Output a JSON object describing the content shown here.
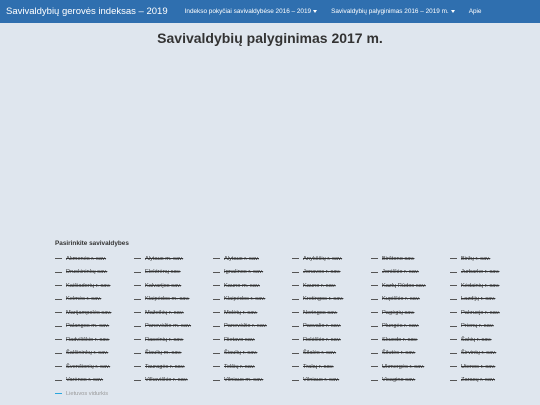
{
  "navbar": {
    "brand": "Savivaldybių gerovės indeksas – 2019",
    "items": [
      {
        "label": "Indekso pokyčiai savivaldybėse 2016 – 2019",
        "dropdown": true
      },
      {
        "label": "Savivaldybių palyginimas 2016 – 2019 m.",
        "dropdown": true
      },
      {
        "label": "Apie",
        "dropdown": false
      }
    ]
  },
  "page": {
    "title": "Savivaldybių palyginimas 2017 m."
  },
  "selector": {
    "title": "Pasirinkite savivaldybes",
    "items": [
      "Akmenės r. sav.",
      "Alytaus m. sav.",
      "Alytaus r. sav.",
      "Anykščių r. sav.",
      "Birštono sav.",
      "Biržų r. sav.",
      "Druskininkų sav.",
      "Elektrėnų sav.",
      "Ignalinos r. sav.",
      "Jonavos r. sav.",
      "Joniškio r. sav.",
      "Jurbarko r. sav.",
      "Kaišiadorių r. sav.",
      "Kalvarijos sav.",
      "Kauno m. sav.",
      "Kauno r. sav.",
      "Kazlų Rūdos sav.",
      "Kėdainių r. sav.",
      "Kelmės r. sav.",
      "Klaipėdos m. sav.",
      "Klaipėdos r. sav.",
      "Kretingos r. sav.",
      "Kupiškio r. sav.",
      "Lazdijų r. sav.",
      "Marijampolės sav.",
      "Mažeikių r. sav.",
      "Molėtų r. sav.",
      "Neringos sav.",
      "Pagėgių sav.",
      "Pakruojo r. sav.",
      "Palangos m. sav.",
      "Panevėžio m. sav.",
      "Panevėžio r. sav.",
      "Pasvalio r. sav.",
      "Plungės r. sav.",
      "Prienų r. sav.",
      "Radviliškio r. sav.",
      "Raseinių r. sav.",
      "Rietavo sav.",
      "Rokiškio r. sav.",
      "Skuodo r. sav.",
      "Šakių r. sav.",
      "Šalčininkų r. sav.",
      "Šiaulių m. sav.",
      "Šiaulių r. sav.",
      "Šilalės r. sav.",
      "Šilutės r. sav.",
      "Širvintų r. sav.",
      "Švenčionių r. sav.",
      "Tauragės r. sav.",
      "Telšių r. sav.",
      "Trakų r. sav.",
      "Ukmergės r. sav.",
      "Utenos r. sav.",
      "Varėnos r. sav.",
      "Vilkaviškio r. sav.",
      "Vilniaus m. sav.",
      "Vilniaus r. sav.",
      "Visagino sav.",
      "Zarasų r. sav."
    ],
    "average": "Lietuvos vidurkis",
    "colors": {
      "disabled_line": "#555555",
      "average_line": "#2aa6dd"
    }
  },
  "colors": {
    "navbar": "#2f6faf",
    "background": "#dfe6ee"
  }
}
